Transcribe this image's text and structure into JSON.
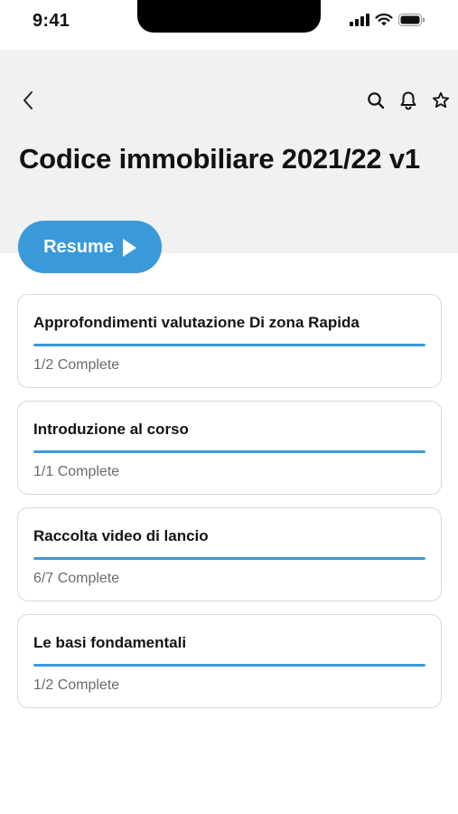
{
  "status_bar": {
    "time": "9:41",
    "icons": [
      "signal-icon",
      "wifi-icon",
      "battery-icon"
    ]
  },
  "nav": {
    "back_icon": "chevron-left-icon",
    "actions": [
      "search-icon",
      "bell-icon",
      "star-icon"
    ]
  },
  "page": {
    "title": "Codice immobiliare 2021/22 v1"
  },
  "resume": {
    "label": "Resume",
    "icon": "play-icon"
  },
  "colors": {
    "accent": "#3a9ad9",
    "header_bg": "#f1f1f1"
  },
  "courses": [
    {
      "title": "Approfondimenti valutazione Di zona Rapida",
      "status": "1/2 Complete",
      "progress": 1.0
    },
    {
      "title": "Introduzione al corso",
      "status": "1/1 Complete",
      "progress": 1.0
    },
    {
      "title": "Raccolta video di lancio",
      "status": "6/7 Complete",
      "progress": 1.0
    },
    {
      "title": "Le basi fondamentali",
      "status": "1/2 Complete",
      "progress": 1.0
    }
  ]
}
